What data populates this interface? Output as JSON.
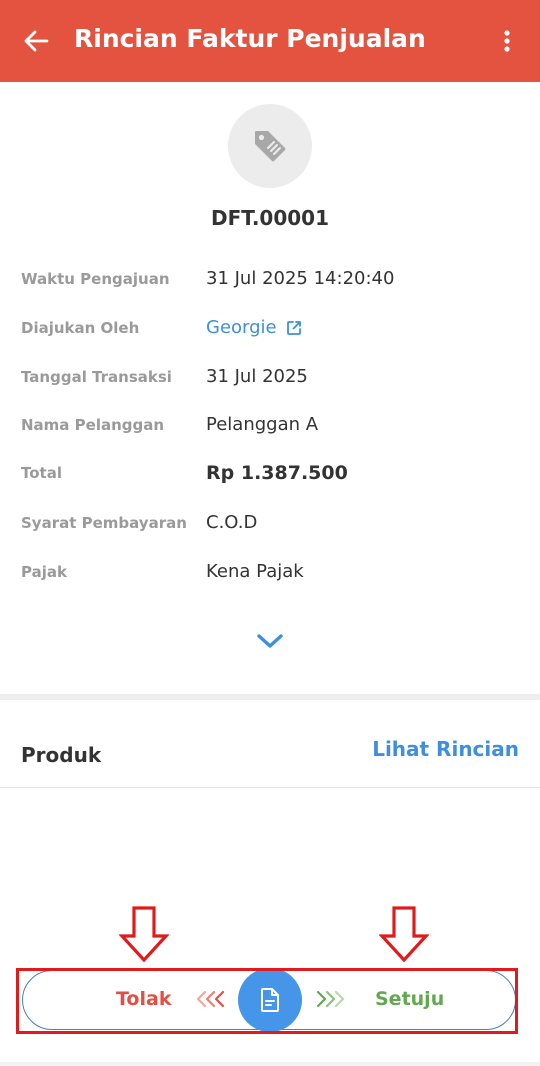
{
  "appbar": {
    "title": "Rincian Faktur Penjualan",
    "back_icon": "arrow-left-icon",
    "more_icon": "more-vertical-icon",
    "color": "#e45240"
  },
  "document": {
    "icon": "tag-icon",
    "number": "DFT.00001"
  },
  "details": [
    {
      "label": "Waktu Pengajuan",
      "value": "31 Jul 2025 14:20:40"
    },
    {
      "label": "Diajukan Oleh",
      "value": "Georgie"
    },
    {
      "label": "Tanggal Transaksi",
      "value": "31 Jul 2025"
    },
    {
      "label": "Nama Pelanggan",
      "value": "Pelanggan A"
    },
    {
      "label": "Total",
      "value": "Rp 1.387.500"
    },
    {
      "label": "Syarat Pembayaran",
      "value": "C.O.D"
    },
    {
      "label": "Pajak",
      "value": "Kena Pajak"
    }
  ],
  "products": {
    "title": "Produk",
    "link": "Lihat Rincian"
  },
  "action_bar": {
    "reject_label": "Tolak",
    "approve_label": "Setuju",
    "handle_icon": "document-icon",
    "reject_color": "#e24f44",
    "approve_color": "#62a850",
    "handle_color": "#4595e8"
  },
  "colors": {
    "link": "#3f8fdd",
    "annotation": "#e11b1b"
  }
}
